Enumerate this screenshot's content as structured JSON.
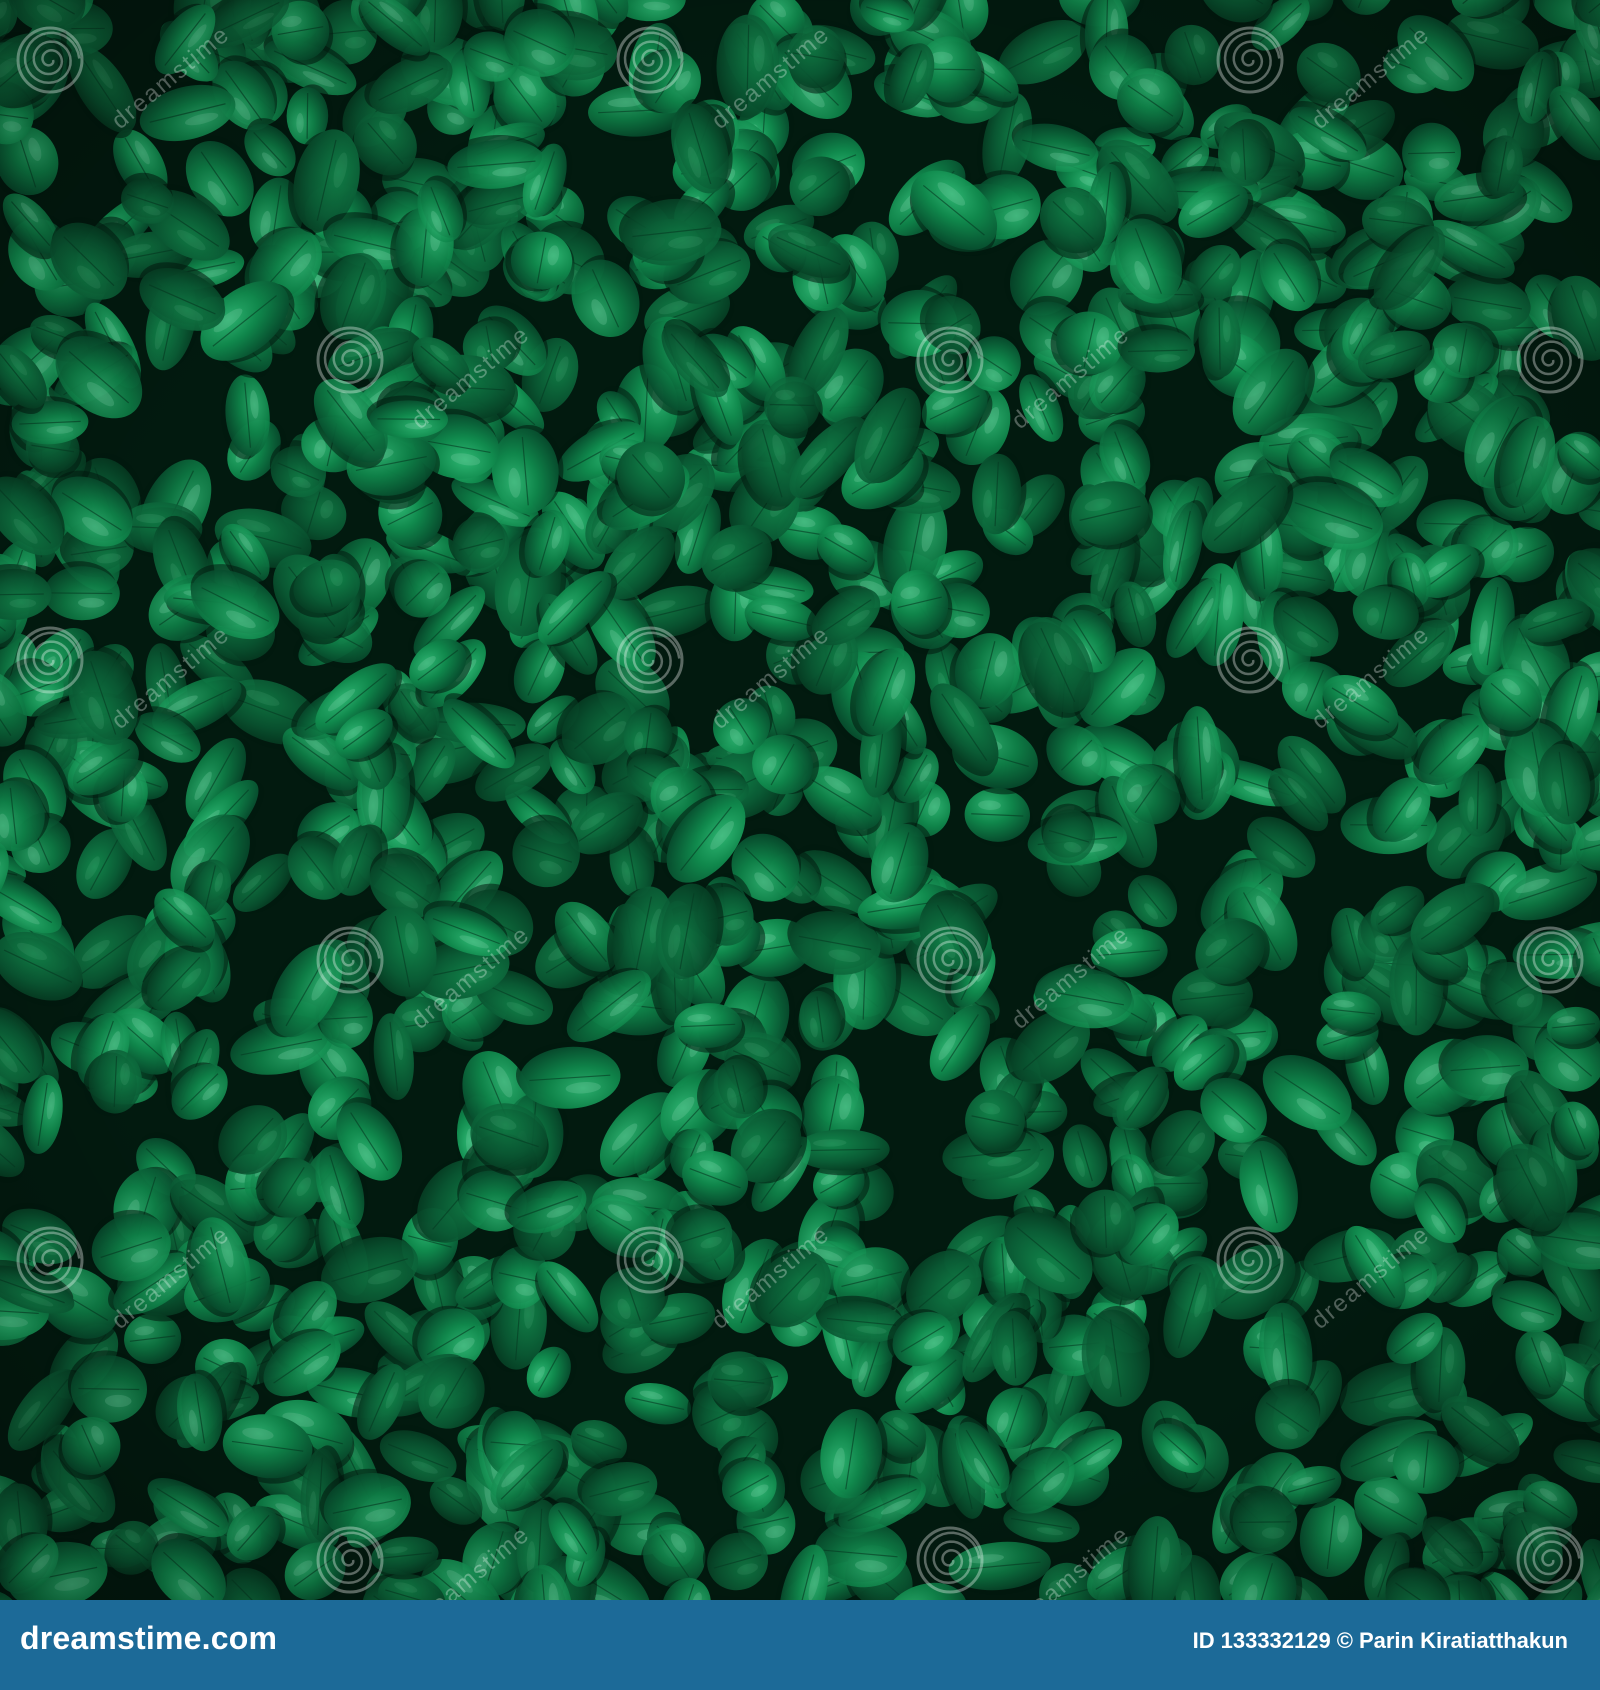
{
  "photo": {
    "subject": "dense-green-leaf-hedge",
    "colors": {
      "shadow": "#021a0f",
      "deep": "#063a22",
      "mid": "#0b6b3e",
      "bright": "#1a9a5c",
      "highlight": "#7fd0a8",
      "footer": "#1c6a98"
    }
  },
  "watermark": {
    "text": "dreamstime",
    "icon": "spiral-logo-icon"
  },
  "footer": {
    "logo_text": "dreamstime.com",
    "id_label": "ID",
    "id_value": "133332129",
    "copyright_symbol": "©",
    "author": "Parin Kiratiatthakun"
  }
}
